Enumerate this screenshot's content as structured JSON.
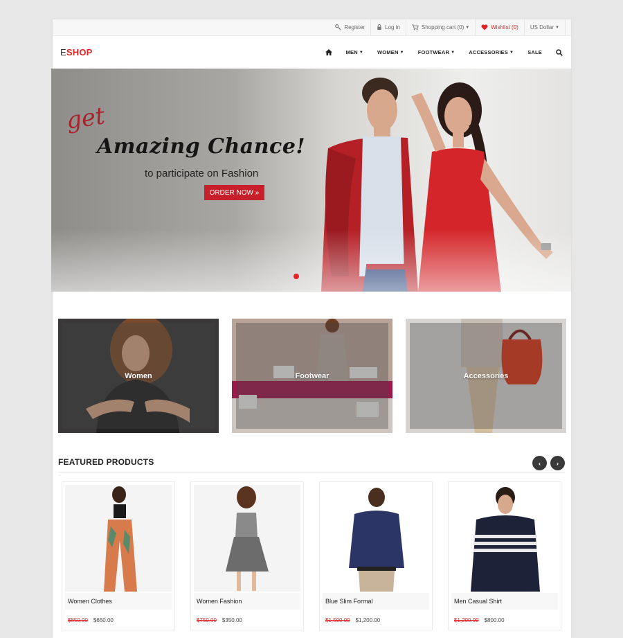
{
  "topbar": {
    "register": "Register",
    "login": "Log in",
    "cart": "Shopping cart (0)",
    "wishlist": "Wishlist (0)",
    "currency": "US Dollar"
  },
  "header": {
    "logo_first": "E",
    "logo_rest": "SHOP",
    "nav": [
      "MEN",
      "WOMEN",
      "FOOTWEAR",
      "ACCESSORIES",
      "SALE"
    ]
  },
  "hero": {
    "get": "get",
    "headline": "Amazing Chance!",
    "sub": "to participate on Fashion",
    "button": "ORDER NOW »"
  },
  "categories": [
    "Women",
    "Footwear",
    "Accessories"
  ],
  "featured": {
    "title": "FEATURED PRODUCTS",
    "products": [
      {
        "name": "Women Clothes",
        "old": "$850.00",
        "price": "$650.00"
      },
      {
        "name": "Women Fashion",
        "old": "$750.00",
        "price": "$350.00"
      },
      {
        "name": "Blue Slim Formal",
        "old": "$1,500.00",
        "price": "$1,200.00"
      },
      {
        "name": "Men Casual Shirt",
        "old": "$1,200.00",
        "price": "$800.00"
      }
    ]
  },
  "colors": {
    "accent": "#e02424",
    "button": "#c8202b",
    "dark": "#3a3a3a"
  }
}
